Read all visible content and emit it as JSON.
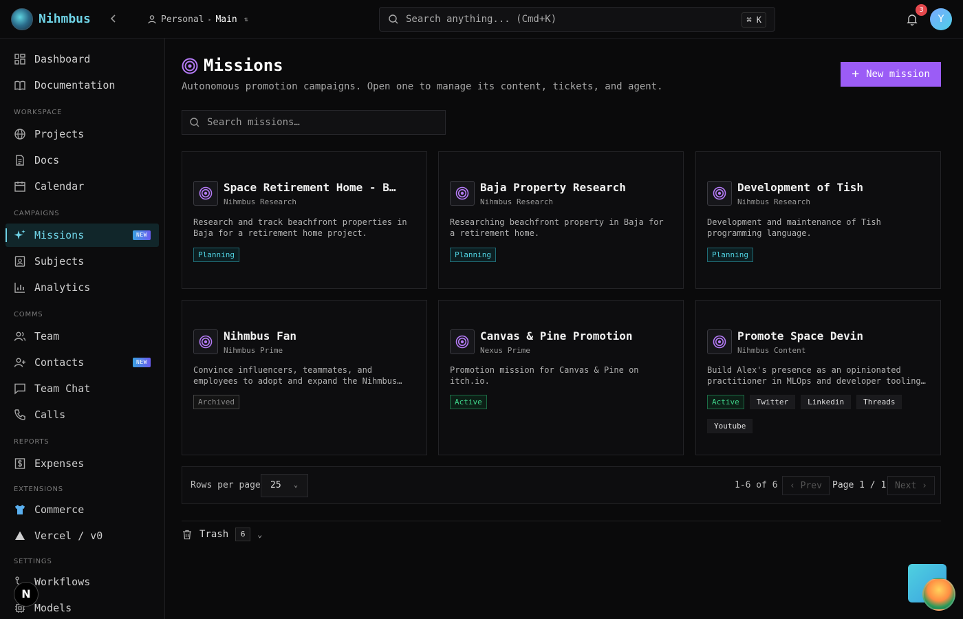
{
  "app": {
    "name": "Nihmbus"
  },
  "workspace": {
    "scope": "Personal",
    "branch": "Main"
  },
  "top_search": {
    "placeholder": "Search anything... (Cmd+K)",
    "shortcut": "⌘ K"
  },
  "notifications": {
    "count": "3"
  },
  "user": {
    "initial": "Y"
  },
  "sidebar": {
    "top_items": [
      {
        "label": "Dashboard",
        "icon": "dashboard-icon"
      },
      {
        "label": "Documentation",
        "icon": "book-icon"
      }
    ],
    "sections": [
      {
        "label": "WORKSPACE",
        "items": [
          {
            "label": "Projects",
            "icon": "globe-icon"
          },
          {
            "label": "Docs",
            "icon": "document-icon"
          },
          {
            "label": "Calendar",
            "icon": "calendar-icon"
          }
        ]
      },
      {
        "label": "CAMPAIGNS",
        "items": [
          {
            "label": "Missions",
            "icon": "sparkle-icon",
            "badge": "NEW",
            "active": true
          },
          {
            "label": "Subjects",
            "icon": "contact-card-icon"
          },
          {
            "label": "Analytics",
            "icon": "bar-chart-icon"
          }
        ]
      },
      {
        "label": "COMMS",
        "items": [
          {
            "label": "Team",
            "icon": "users-icon"
          },
          {
            "label": "Contacts",
            "icon": "user-plus-icon",
            "badge": "NEW"
          },
          {
            "label": "Team Chat",
            "icon": "chat-icon"
          },
          {
            "label": "Calls",
            "icon": "phone-icon"
          }
        ]
      },
      {
        "label": "REPORTS",
        "items": [
          {
            "label": "Expenses",
            "icon": "dollar-icon"
          }
        ]
      },
      {
        "label": "EXTENSIONS",
        "items": [
          {
            "label": "Commerce",
            "icon": "shirt-icon"
          },
          {
            "label": "Vercel / v0",
            "icon": "triangle-icon"
          }
        ]
      },
      {
        "label": "SETTINGS",
        "items": [
          {
            "label": "Workflows",
            "icon": "workflow-icon"
          },
          {
            "label": "Models",
            "icon": "chip-icon"
          }
        ]
      }
    ],
    "bottom_badge": "N"
  },
  "page": {
    "title": "Missions",
    "subtitle": "Autonomous promotion campaigns. Open one to manage its content, tickets, and agent.",
    "new_button": "New mission",
    "search_placeholder": "Search missions…"
  },
  "missions": [
    {
      "title": "Space Retirement Home - Baja",
      "org": "Nihmbus Research",
      "description": "Research and track beachfront properties in Baja for a retirement home project.",
      "status": "Planning",
      "platforms": []
    },
    {
      "title": "Baja Property Research",
      "org": "Nihmbus Research",
      "description": "Researching beachfront property in Baja for a retirement home.",
      "status": "Planning",
      "platforms": []
    },
    {
      "title": "Development of Tish",
      "org": "Nihmbus Research",
      "description": "Development and maintenance of Tish programming language.",
      "status": "Planning",
      "platforms": []
    },
    {
      "title": "Nihmbus Fan",
      "org": "Nihmbus Prime",
      "description": "Convince influencers, teammates, and employees to adopt and expand the Nihmbus platform.",
      "status": "Archived",
      "platforms": []
    },
    {
      "title": "Canvas & Pine Promotion",
      "org": "Nexus Prime",
      "description": "Promotion mission for Canvas & Pine on itch.io.",
      "status": "Active",
      "platforms": []
    },
    {
      "title": "Promote Space Devin",
      "org": "Nihmbus Content",
      "description": "Build Alex's presence as an opinionated practitioner in MLOps and developer tooling across platforms.",
      "status": "Active",
      "platforms": [
        "Twitter",
        "Linkedin",
        "Threads",
        "Youtube"
      ]
    }
  ],
  "pagination": {
    "rows_label": "Rows per page",
    "rows_value": "25",
    "range": "1-6 of 6",
    "prev": "Prev",
    "page_info": "Page 1 / 1",
    "next": "Next"
  },
  "trash": {
    "label": "Trash",
    "count": "6"
  }
}
